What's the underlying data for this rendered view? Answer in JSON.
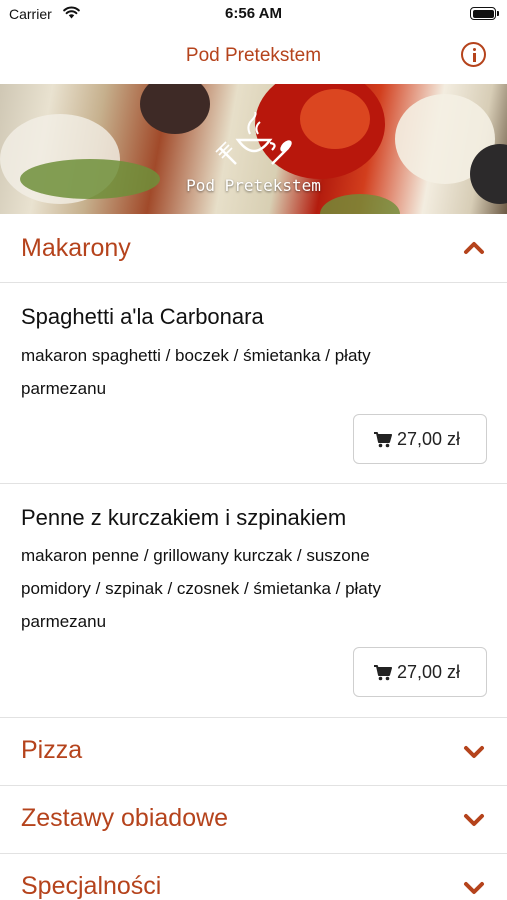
{
  "status_bar": {
    "carrier": "Carrier",
    "time": "6:56 AM"
  },
  "nav": {
    "title": "Pod Pretekstem"
  },
  "banner": {
    "logo_text": "Pod Pretekstem"
  },
  "sections": [
    {
      "title": "Makarony",
      "expanded": true,
      "items": [
        {
          "name": "Spaghetti a'la Carbonara",
          "desc_lines": [
            "makaron spaghetti / boczek / śmietanka / płaty",
            "parmezanu"
          ],
          "price": "27,00 zł"
        },
        {
          "name": "Penne z kurczakiem i szpinakiem",
          "desc_lines": [
            "makaron penne / grillowany kurczak / suszone",
            "pomidory / szpinak / czosnek / śmietanka / płaty",
            "parmezanu"
          ],
          "price": "27,00 zł"
        }
      ]
    },
    {
      "title": "Pizza",
      "expanded": false
    },
    {
      "title": "Zestawy obiadowe",
      "expanded": false
    },
    {
      "title": "Specjalności",
      "expanded": false
    }
  ],
  "colors": {
    "accent": "#b5431c",
    "divider": "#e2e2e2",
    "text": "#111111"
  },
  "icons": {
    "wifi": "wifi-icon",
    "battery": "battery-icon",
    "info": "info-icon",
    "cart": "cart-icon",
    "chevron_up": "chevron-up-icon",
    "chevron_down": "chevron-down-icon"
  }
}
